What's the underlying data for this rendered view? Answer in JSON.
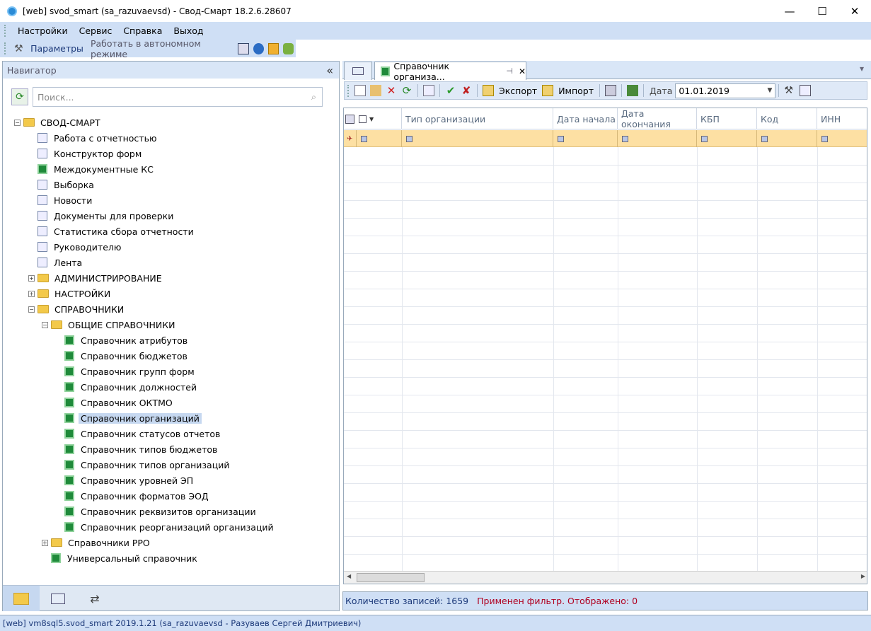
{
  "window": {
    "title": "[web] svod_smart (sa_razuvaevsd) - Свод-Смарт 18.2.6.28607",
    "minimize": "—",
    "maximize": "☐",
    "close": "✕"
  },
  "menu": [
    "Настройки",
    "Сервис",
    "Справка",
    "Выход"
  ],
  "toolbar": {
    "params": "Параметры",
    "offline": "Работать в автономном режиме"
  },
  "navigator": {
    "title": "Навигатор",
    "collapse": "«",
    "search_placeholder": "Поиск...",
    "tree": [
      {
        "label": "СВОД-СМАРТ",
        "level": 0,
        "kind": "folder",
        "exp": "−"
      },
      {
        "label": "Работа с отчетностью",
        "level": 1,
        "kind": "item"
      },
      {
        "label": "Конструктор форм",
        "level": 1,
        "kind": "item"
      },
      {
        "label": "Междокументные КС",
        "level": 1,
        "kind": "green"
      },
      {
        "label": "Выборка",
        "level": 1,
        "kind": "item"
      },
      {
        "label": "Новости",
        "level": 1,
        "kind": "item"
      },
      {
        "label": "Документы для проверки",
        "level": 1,
        "kind": "item"
      },
      {
        "label": "Статистика сбора отчетности",
        "level": 1,
        "kind": "item"
      },
      {
        "label": "Руководителю",
        "level": 1,
        "kind": "item"
      },
      {
        "label": "Лента",
        "level": 1,
        "kind": "item"
      },
      {
        "label": "АДМИНИСТРИРОВАНИЕ",
        "level": 1,
        "kind": "folder",
        "exp": "+"
      },
      {
        "label": "НАСТРОЙКИ",
        "level": 1,
        "kind": "folder",
        "exp": "+"
      },
      {
        "label": "СПРАВОЧНИКИ",
        "level": 1,
        "kind": "folder",
        "exp": "−"
      },
      {
        "label": "ОБЩИЕ СПРАВОЧНИКИ",
        "level": 2,
        "kind": "folder",
        "exp": "−"
      },
      {
        "label": "Справочник атрибутов",
        "level": 3,
        "kind": "green"
      },
      {
        "label": "Справочник бюджетов",
        "level": 3,
        "kind": "green"
      },
      {
        "label": "Справочник групп форм",
        "level": 3,
        "kind": "green"
      },
      {
        "label": "Справочник должностей",
        "level": 3,
        "kind": "green"
      },
      {
        "label": "Справочник ОКТМО",
        "level": 3,
        "kind": "green"
      },
      {
        "label": "Справочник организаций",
        "level": 3,
        "kind": "green",
        "selected": true
      },
      {
        "label": "Справочник статусов отчетов",
        "level": 3,
        "kind": "green"
      },
      {
        "label": "Справочник типов бюджетов",
        "level": 3,
        "kind": "green"
      },
      {
        "label": "Справочник типов организаций",
        "level": 3,
        "kind": "green"
      },
      {
        "label": "Справочник уровней ЭП",
        "level": 3,
        "kind": "green"
      },
      {
        "label": "Справочник форматов ЭОД",
        "level": 3,
        "kind": "green"
      },
      {
        "label": "Справочник реквизитов организации",
        "level": 3,
        "kind": "green"
      },
      {
        "label": "Справочник реорганизаций организаций",
        "level": 3,
        "kind": "green"
      },
      {
        "label": "Справочники РРО",
        "level": 2,
        "kind": "folder",
        "exp": "+"
      },
      {
        "label": "Универсальный справочник",
        "level": 2,
        "kind": "green"
      }
    ]
  },
  "tab": {
    "label": "Справочник организа...",
    "pin": "⊣",
    "close": "✕",
    "menu": "▾"
  },
  "grid_toolbar": {
    "export": "Экспорт",
    "import": "Импорт",
    "date_label": "Дата",
    "date_value": "01.01.2019"
  },
  "grid": {
    "columns": [
      "Тип организации",
      "Дата начала",
      "Дата окончания",
      "КБП",
      "Код",
      "ИНН"
    ],
    "row_count": 24
  },
  "status": {
    "count": "Количество записей: 1659",
    "filter": "Применен фильтр. Отображено: 0"
  },
  "bottom_status": "[web] vm8sql5.svod_smart 2019.1.21 (sa_razuvaevsd - Разуваев Сергей Дмитриевич)",
  "colors": {
    "accent": "#cfdff5",
    "filter_row": "#fde0a3",
    "status_red": "#b00020"
  }
}
